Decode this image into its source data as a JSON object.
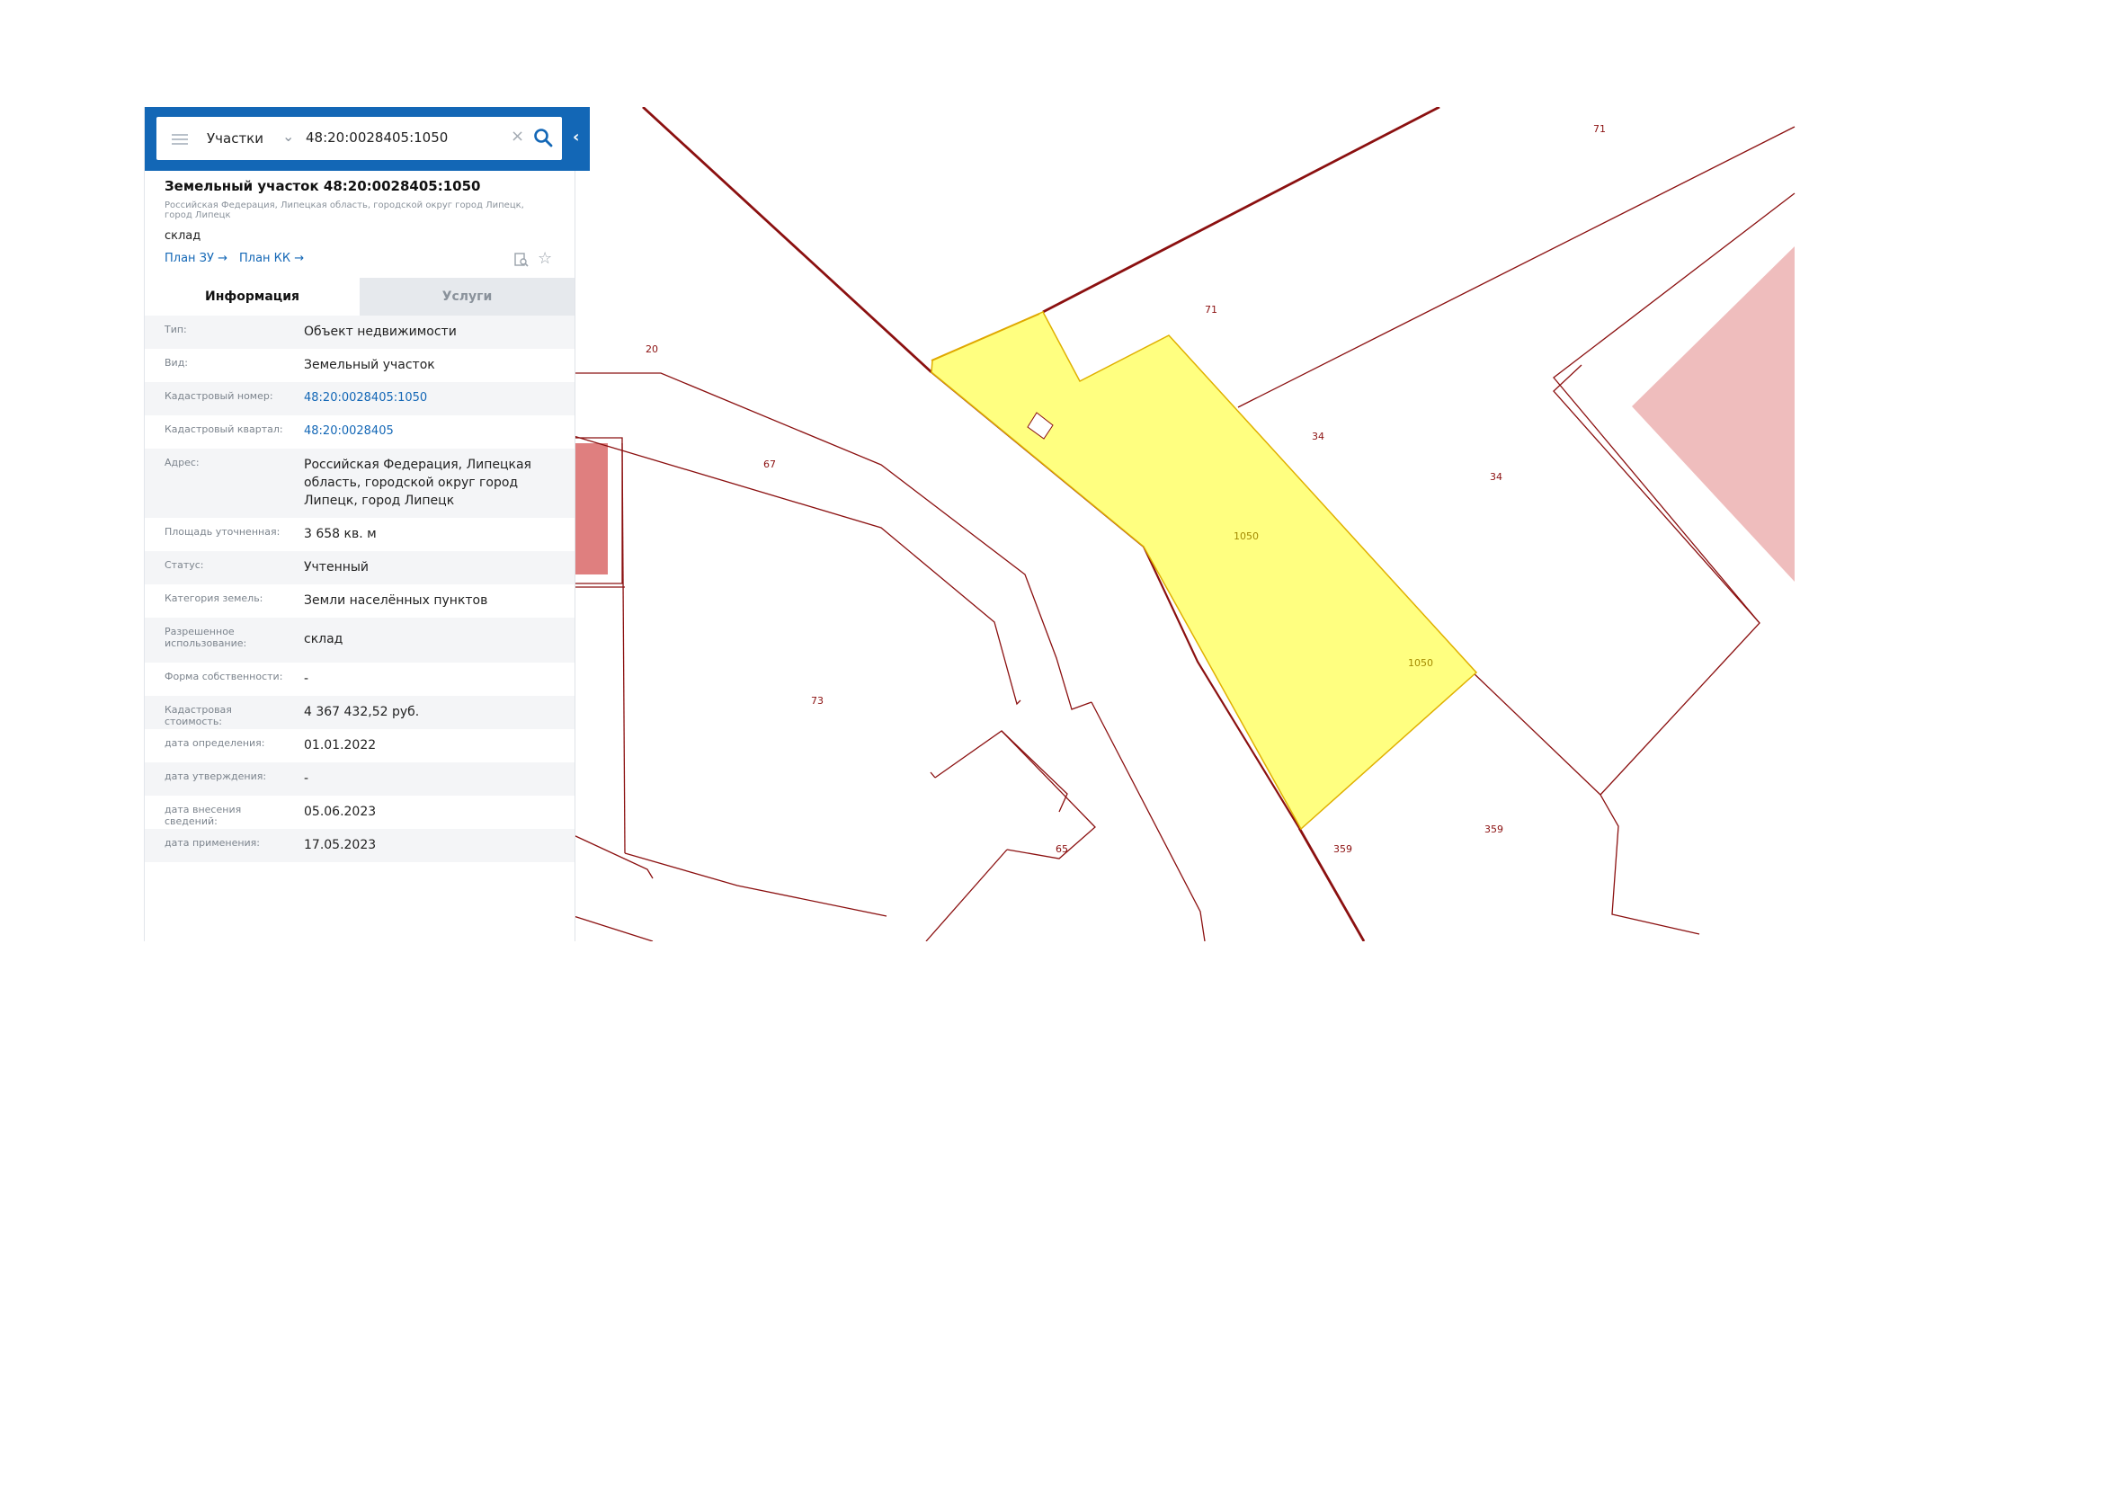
{
  "search": {
    "category": "Участки",
    "query": "48:20:0028405:1050"
  },
  "object": {
    "title": "Земельный участок 48:20:0028405:1050",
    "address_small": "Российская Федерация, Липецкая область, городской округ город Липецк, город Липецк",
    "usage": "склад",
    "links": {
      "plan_zu": "План ЗУ →",
      "plan_kk": "План КК →"
    }
  },
  "tabs": {
    "info": "Информация",
    "services": "Услуги"
  },
  "details": {
    "rows": [
      {
        "key": "Тип:",
        "value": "Объект недвижимости"
      },
      {
        "key": "Вид:",
        "value": "Земельный участок"
      },
      {
        "key": "Кадастровый номер:",
        "value": "48:20:0028405:1050"
      },
      {
        "key": "Кадастровый квартал:",
        "value": "48:20:0028405"
      },
      {
        "key": "Адрес:",
        "value": "Российская Федерация, Липецкая область, городской округ город Липецк, город Липецк"
      },
      {
        "key": "Площадь уточненная:",
        "value": "3 658 кв. м"
      },
      {
        "key": "Статус:",
        "value": "Учтенный"
      },
      {
        "key": "Категория земель:",
        "value": "Земли населённых пунктов"
      },
      {
        "key": "Разрешенное использование:",
        "value": "склад"
      },
      {
        "key": "Форма собственности:",
        "value": "-"
      },
      {
        "key": "Кадастровая стоимость:",
        "value": "4 367 432,52 руб."
      },
      {
        "key": "дата определения:",
        "value": "01.01.2022"
      },
      {
        "key": "дата утверждения:",
        "value": "-"
      },
      {
        "key": "дата внесения сведений:",
        "value": "05.06.2023"
      },
      {
        "key": "дата применения:",
        "value": "17.05.2023"
      }
    ]
  },
  "map": {
    "labels": [
      "71",
      "71",
      "20",
      "67",
      "34",
      "34",
      "1050",
      "1050",
      "73",
      "65",
      "359",
      "359"
    ],
    "colors": {
      "boundary": "#8b1010",
      "selected_fill": "#ffff80",
      "selected_stroke": "#e0b000",
      "pink_area": "#efbdbd",
      "red_block": "#df7f7f"
    }
  }
}
